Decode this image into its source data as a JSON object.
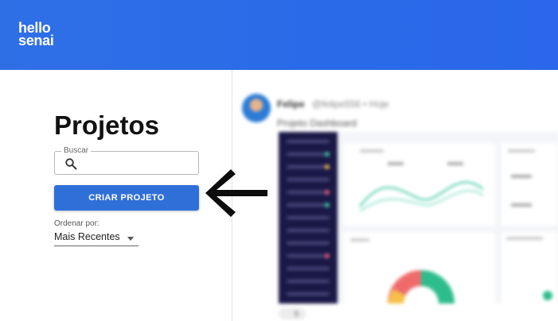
{
  "brand": {
    "logo_line1": "hello",
    "logo_line2": "senai"
  },
  "projects": {
    "title": "Projetos",
    "search": {
      "label": "Buscar",
      "value": "",
      "placeholder": ""
    },
    "create_button": "CRIAR PROJETO",
    "sort": {
      "label": "Ordenar por:",
      "selected": "Mais Recentes"
    }
  },
  "feed": {
    "post": {
      "author": "Felipe",
      "handle": "@felipe556",
      "time": "• Hoje",
      "title": "Projeto Dashboard",
      "comment_count": "5"
    }
  },
  "colors": {
    "header": "#2f6fe6",
    "primary_button": "#2f6fd8"
  }
}
